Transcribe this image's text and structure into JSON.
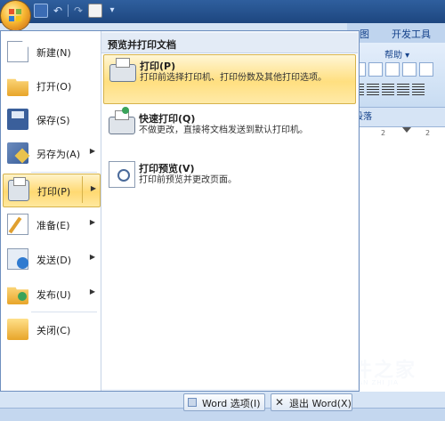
{
  "ribbon": {
    "tabs": [
      "图",
      "开发工具"
    ],
    "help_label": "帮助",
    "group_label": "段落"
  },
  "ruler": {
    "ticks": [
      "2",
      "2"
    ]
  },
  "menu": {
    "items": [
      {
        "label": "新建(N)",
        "icon": "new-document-icon",
        "arrow": ""
      },
      {
        "label": "打开(O)",
        "icon": "open-folder-icon",
        "arrow": ""
      },
      {
        "label": "保存(S)",
        "icon": "save-disk-icon",
        "arrow": ""
      },
      {
        "label": "另存为(A)",
        "icon": "save-as-icon",
        "arrow": "▶"
      },
      {
        "label": "打印(P)",
        "icon": "printer-icon",
        "arrow": "▶"
      },
      {
        "label": "准备(E)",
        "icon": "prepare-icon",
        "arrow": "▶"
      },
      {
        "label": "发送(D)",
        "icon": "send-icon",
        "arrow": "▶"
      },
      {
        "label": "发布(U)",
        "icon": "publish-icon",
        "arrow": "▶"
      },
      {
        "label": "关闭(C)",
        "icon": "close-folder-icon",
        "arrow": ""
      }
    ],
    "active_item": "打印(P)"
  },
  "submenu": {
    "title": "预览并打印文档",
    "items": [
      {
        "title": "打印(P)",
        "desc": "打印前选择打印机、打印份数及其他打印选项。",
        "icon": "printer-icon"
      },
      {
        "title": "快速打印(Q)",
        "desc": "不做更改，直接将文档发送到默认打印机。",
        "icon": "quick-print-icon"
      },
      {
        "title": "打印预览(V)",
        "desc": "打印前预览并更改页面。",
        "icon": "print-preview-icon"
      }
    ]
  },
  "buttons": {
    "word_options": "Word 选项(I)",
    "exit_word": "退出 Word(X)"
  },
  "watermark": {
    "title": "硬件之家",
    "subtitle": "YING JIAN ZHI JIA"
  }
}
